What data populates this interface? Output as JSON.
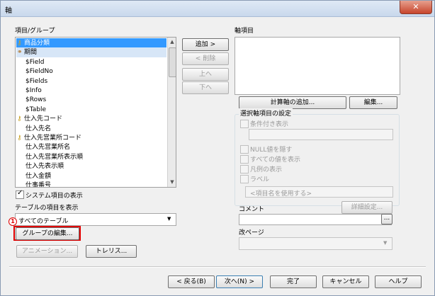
{
  "window": {
    "title": "軸",
    "close_glyph": "✕"
  },
  "left": {
    "list_label": "項目/グループ",
    "items": [
      {
        "label": "商品分類",
        "icon": "key-icon",
        "selected": true
      },
      {
        "label": "期間",
        "icon": "group-icon",
        "highlighted": true
      },
      {
        "label": "$Field"
      },
      {
        "label": "$FieldNo"
      },
      {
        "label": "$Fields"
      },
      {
        "label": "$Info"
      },
      {
        "label": "$Rows"
      },
      {
        "label": "$Table"
      },
      {
        "label": "仕入先コード",
        "icon": "key-icon"
      },
      {
        "label": "仕入先名"
      },
      {
        "label": "仕入先営業所コード",
        "icon": "key-icon"
      },
      {
        "label": "仕入先営業所名"
      },
      {
        "label": "仕入先営業所表示順"
      },
      {
        "label": "仕入先表示順"
      },
      {
        "label": "仕入金額"
      },
      {
        "label": "仕事番号"
      }
    ],
    "show_system_label": "システム項目の表示",
    "show_table_label": "テーブルの項目を表示",
    "table_select_value": "すべてのテーブル",
    "edit_group_label": "グループの編集...",
    "animation_label": "アニメーション...",
    "trellis_label": "トレリス..."
  },
  "middle": {
    "add_label": "追加 >",
    "remove_label": "< 削除",
    "up_label": "上へ",
    "down_label": "下へ"
  },
  "right": {
    "axis_items_label": "軸項目",
    "add_calc_label": "計算軸の追加...",
    "edit_label": "編集...",
    "settings_label": "選択軸項目の設定",
    "conditional_label": "条件付き表示",
    "hide_null_label": "NULL値を隠す",
    "show_all_label": "すべての値を表示",
    "legend_label": "凡例の表示",
    "label_label": "ラベル",
    "label_placeholder": "<項目名を使用する>",
    "detail_settings_label": "詳細設定...",
    "comment_label": "コメント",
    "page_break_label": "改ページ"
  },
  "footer": {
    "back_label": "< 戻る(B)",
    "next_label": "次へ(N) >",
    "finish_label": "完了",
    "cancel_label": "キャンセル",
    "help_label": "ヘルプ"
  },
  "annotation": {
    "marker": "1"
  },
  "colors": {
    "selection": "#3399ff",
    "annotation": "#e00000"
  }
}
